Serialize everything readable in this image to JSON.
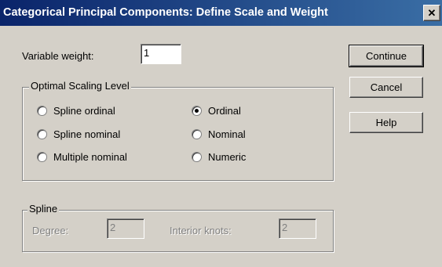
{
  "window": {
    "title": "Categorical Principal Components: Define Scale and Weight",
    "close_symbol": "✕"
  },
  "variable_weight": {
    "label": "Variable weight:",
    "value": "1"
  },
  "optimal_scaling": {
    "group_label": "Optimal Scaling Level",
    "options": [
      {
        "label": "Spline ordinal",
        "checked": false
      },
      {
        "label": "Spline nominal",
        "checked": false
      },
      {
        "label": "Multiple nominal",
        "checked": false
      },
      {
        "label": "Ordinal",
        "checked": true
      },
      {
        "label": "Nominal",
        "checked": false
      },
      {
        "label": "Numeric",
        "checked": false
      }
    ]
  },
  "spline": {
    "group_label": "Spline",
    "degree_label": "Degree:",
    "degree_value": "2",
    "interior_knots_label": "Interior knots:",
    "interior_knots_value": "2"
  },
  "buttons": {
    "continue": "Continue",
    "cancel": "Cancel",
    "help": "Help"
  },
  "colors": {
    "title_start": "#0a246a",
    "title_end": "#3a6ea5",
    "face": "#d4d0c8"
  }
}
